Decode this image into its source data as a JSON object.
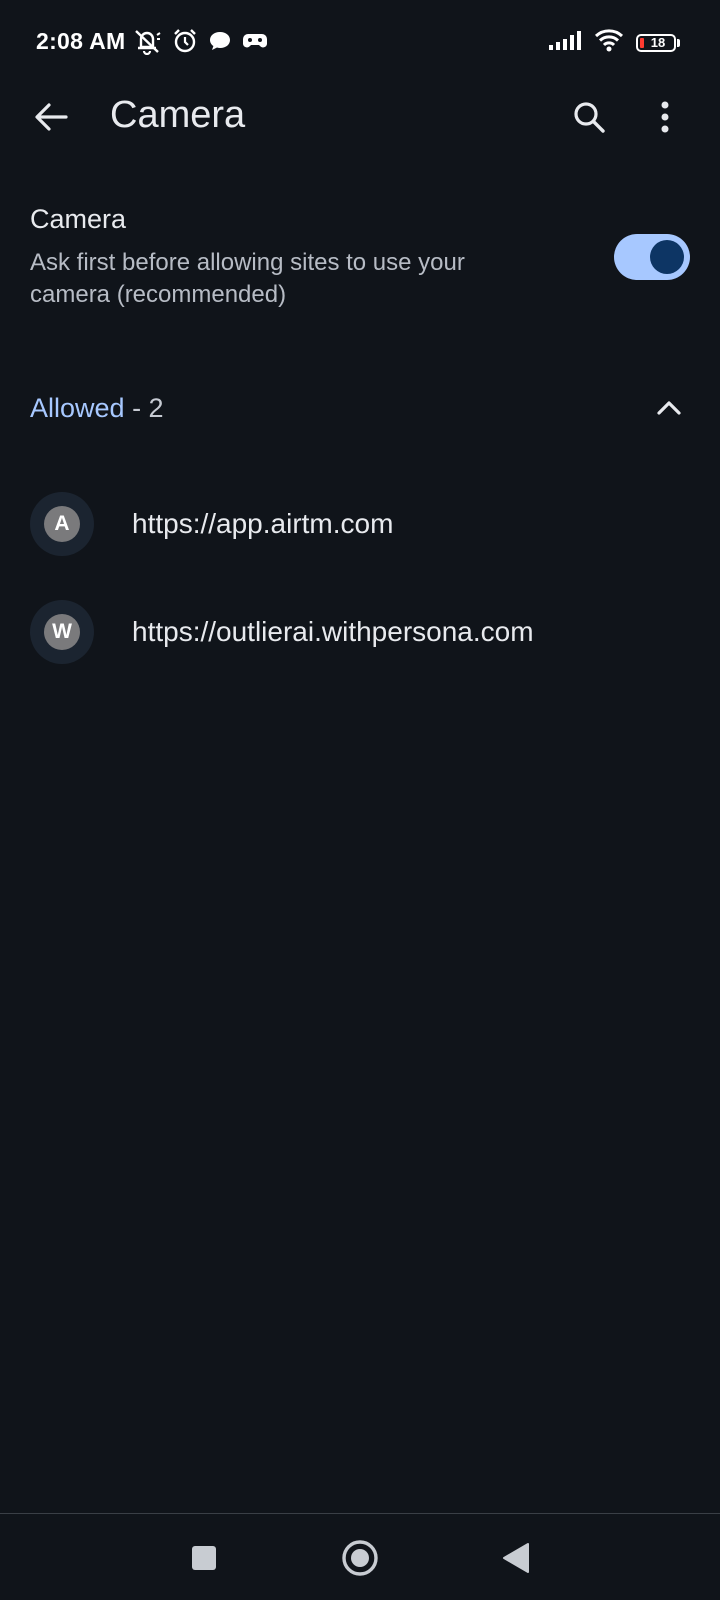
{
  "status_bar": {
    "time": "2:08 AM",
    "battery_level": "18",
    "left_icons": [
      "mute-icon",
      "alarm-icon",
      "chat-bubble-icon",
      "game-controller-icon"
    ],
    "right_icons": [
      "signal-icon",
      "wifi-icon",
      "battery-icon"
    ]
  },
  "app_bar": {
    "title": "Camera",
    "back_icon": "arrow-back-icon",
    "search_icon": "search-icon",
    "more_icon": "more-vert-icon"
  },
  "setting": {
    "title": "Camera",
    "description": "Ask first before allowing sites to use your camera (recommended)",
    "enabled": true
  },
  "section": {
    "label": "Allowed",
    "count_text": " - 2",
    "expanded": true
  },
  "sites": [
    {
      "initial": "A",
      "url": "https://app.airtm.com"
    },
    {
      "initial": "W",
      "url": "https://outlierai.withpersona.com"
    }
  ],
  "nav_bar": {
    "buttons": [
      "recents-icon",
      "home-icon",
      "back-nav-icon"
    ]
  },
  "colors": {
    "background": "#10141a",
    "accent": "#a7c8ff",
    "toggle_knob": "#0d3564",
    "avatar": "#7a7a7c",
    "battery_low": "#ff3b30"
  }
}
